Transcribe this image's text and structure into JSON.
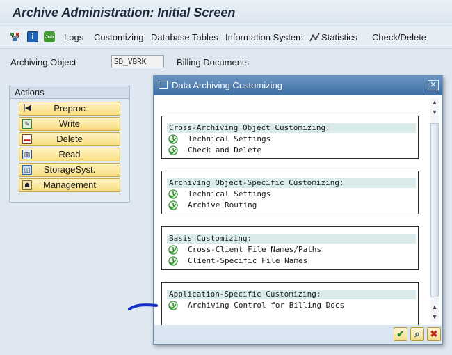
{
  "window": {
    "title": "Archive Administration: Initial Screen"
  },
  "toolbar": {
    "icons": [
      "hierarchy-icon",
      "info-icon",
      "job-icon"
    ],
    "job_icon_text": "Job",
    "items": [
      {
        "label": "Logs"
      },
      {
        "label": "Customizing"
      },
      {
        "label": "Database Tables"
      },
      {
        "label": "Information System"
      },
      {
        "label": "Statistics",
        "icon": "statistics-icon"
      },
      {
        "label": "Check/Delete"
      }
    ]
  },
  "archiving_object": {
    "label": "Archiving Object",
    "value": "SD_VBRK",
    "description": "Billing Documents"
  },
  "actions": {
    "title": "Actions",
    "buttons": [
      {
        "label": "Preproc",
        "icon": "skip-back-icon"
      },
      {
        "label": "Write",
        "icon": "write-icon"
      },
      {
        "label": "Delete",
        "icon": "delete-icon"
      },
      {
        "label": "Read",
        "icon": "read-icon"
      },
      {
        "label": "StorageSyst.",
        "icon": "storage-icon"
      },
      {
        "label": "Management",
        "icon": "management-icon"
      }
    ]
  },
  "dialog": {
    "title": "Data Archiving Customizing",
    "sections": [
      {
        "heading": "Cross-Archiving Object Customizing:",
        "items": [
          {
            "label": "Technical Settings"
          },
          {
            "label": "Check and Delete"
          }
        ]
      },
      {
        "heading": "Archiving Object-Specific Customizing:",
        "items": [
          {
            "label": "Technical Settings"
          },
          {
            "label": "Archive Routing"
          }
        ]
      },
      {
        "heading": "Basis Customizing:",
        "items": [
          {
            "label": "Cross-Client File Names/Paths"
          },
          {
            "label": "Client-Specific File Names"
          }
        ]
      },
      {
        "heading": "Application-Specific Customizing:",
        "items": [
          {
            "label": "Archiving Control for Billing Docs"
          }
        ]
      }
    ],
    "footer_buttons": [
      "confirm-icon",
      "search-icon",
      "cancel-icon"
    ]
  },
  "colors": {
    "accent": "#3f6fa4",
    "action_button": "#f7dc7e",
    "section_header": "#d9ebea",
    "annotation": "#1530c8"
  }
}
